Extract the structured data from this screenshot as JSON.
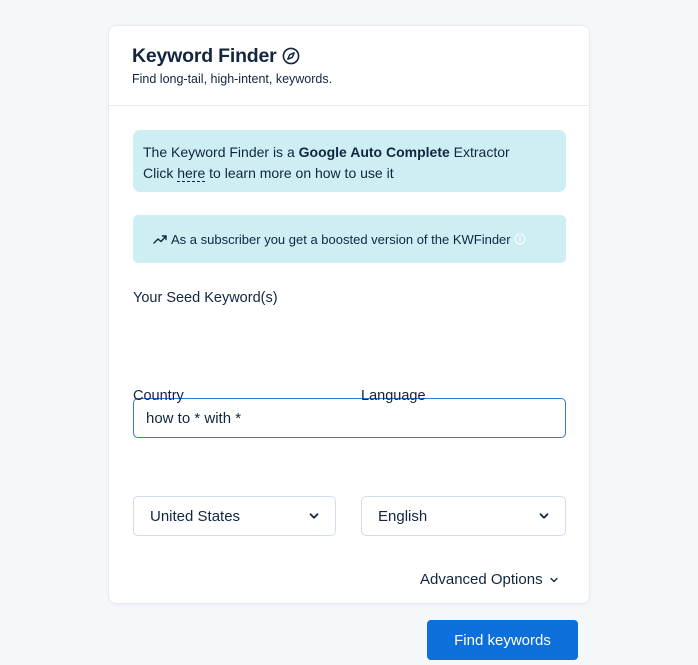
{
  "header": {
    "title": "Keyword Finder",
    "subtitle": "Find long-tail, high-intent, keywords."
  },
  "info": {
    "line1_prefix": "The Keyword Finder is a ",
    "line1_bold": "Google Auto Complete",
    "line1_suffix": " Extractor",
    "line2_prefix": "Click ",
    "line2_link": "here",
    "line2_suffix": " to learn more on how to use it"
  },
  "boost": {
    "text": "As a subscriber you get a boosted version of the KWFinder"
  },
  "seed": {
    "label": "Your Seed Keyword(s)",
    "value": "how to * with *"
  },
  "country": {
    "label": "Country",
    "selected": "United States"
  },
  "language": {
    "label": "Language",
    "selected": "English"
  },
  "advanced": {
    "label": "Advanced Options"
  },
  "actions": {
    "find_label": "Find keywords"
  },
  "colors": {
    "accent": "#0d6fd9",
    "info_bg": "#cdeef3",
    "text": "#12263f",
    "page_bg": "#f5f8fb"
  },
  "icons": {
    "title": "compass-icon",
    "boost": "trending-up-icon",
    "boost_help": "info-circle-icon",
    "select": "chevron-down-icon"
  }
}
